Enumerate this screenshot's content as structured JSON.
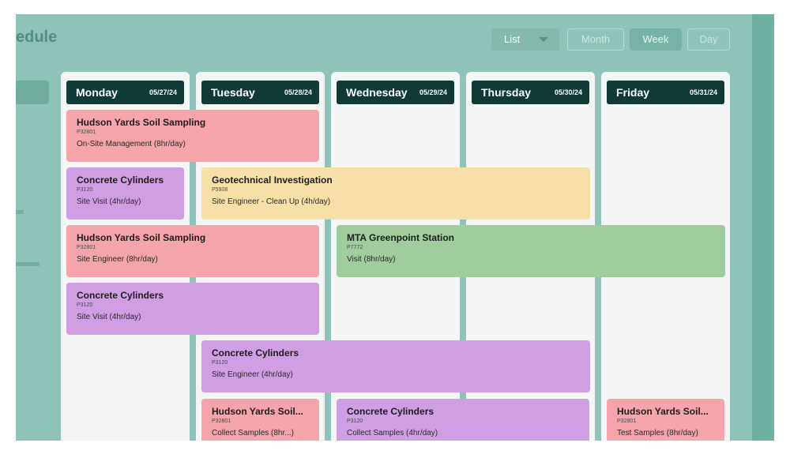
{
  "header": {
    "title": "edule",
    "view_select": "List",
    "buttons": {
      "month": "Month",
      "week": "Week",
      "day": "Day"
    }
  },
  "days": [
    {
      "name": "Monday",
      "date": "05/27/24"
    },
    {
      "name": "Tuesday",
      "date": "05/28/24"
    },
    {
      "name": "Wednesday",
      "date": "05/29/24"
    },
    {
      "name": "Thursday",
      "date": "05/30/24"
    },
    {
      "name": "Friday",
      "date": "05/31/24"
    }
  ],
  "events": [
    {
      "title": "Hudson Yards Soil Sampling",
      "code": "P32801",
      "desc": "On-Site Management (8hr/day)"
    },
    {
      "title": "Concrete Cylinders",
      "code": "P3120",
      "desc": "Site Visit (4hr/day)"
    },
    {
      "title": "Geotechnical Investigation",
      "code": "P5908",
      "desc": "Site Engineer - Clean Up (4h/day)"
    },
    {
      "title": "Hudson Yards Soil Sampling",
      "code": "P32801",
      "desc": "Site Engineer (8hr/day)"
    },
    {
      "title": "MTA Greenpoint Station",
      "code": "P7772",
      "desc": "Visit (8hr/day)"
    },
    {
      "title": "Concrete Cylinders",
      "code": "P3120",
      "desc": "Site Visit (4hr/day)"
    },
    {
      "title": "Concrete Cylinders",
      "code": "P3120",
      "desc": "Site Engineer (4hr/day)"
    },
    {
      "title": "Hudson Yards Soil...",
      "code": "P32801",
      "desc": "Collect Samples (8hr...)"
    },
    {
      "title": "Concrete Cylinders",
      "code": "P3120",
      "desc": "Collect Samples (4hr/day)"
    },
    {
      "title": "Hudson Yards Soil...",
      "code": "P32801",
      "desc": "Test Samples (8hr/day)"
    }
  ],
  "colors": {
    "pink": "#f5a4ab",
    "purple": "#cf9ee3",
    "yellow": "#f6e0a8",
    "green": "#a0cc9e",
    "day_header": "#0f3a36",
    "backdrop": "#8fc2b8"
  },
  "icons": {
    "view_select_caret": "caret-down-icon"
  }
}
